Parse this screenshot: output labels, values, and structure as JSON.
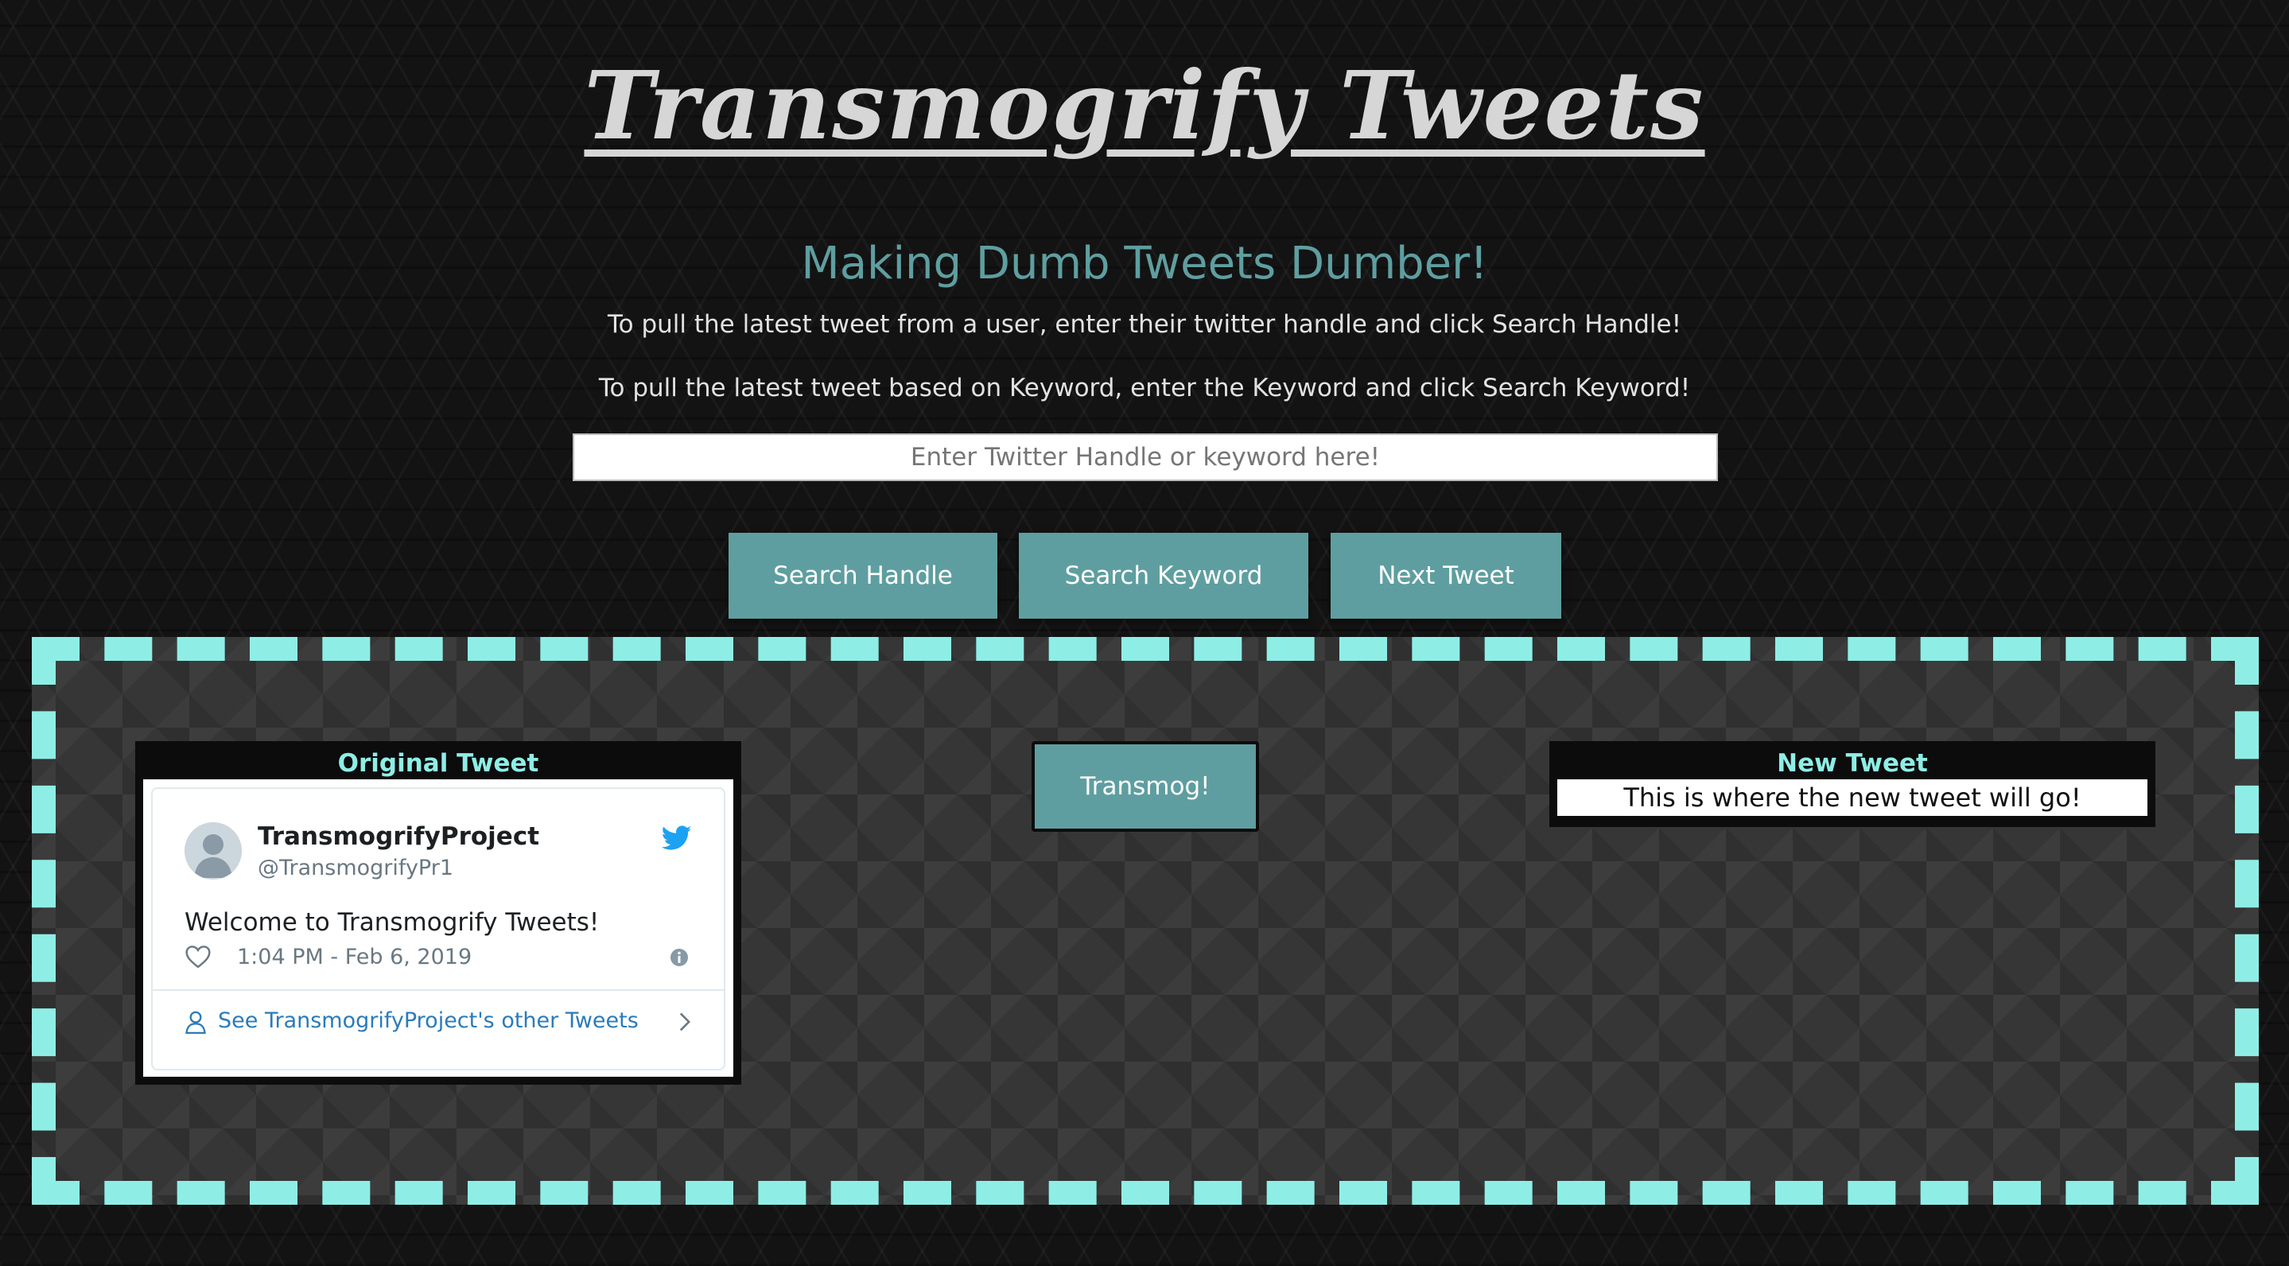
{
  "header": {
    "title": "Transmogrify Tweets",
    "subtitle": "Making Dumb Tweets Dumber!",
    "instruction_handle": "To pull the latest tweet from a user, enter their twitter handle and click Search Handle!",
    "instruction_keyword": "To pull the latest tweet based on Keyword, enter the Keyword and click Search Keyword!"
  },
  "search": {
    "placeholder": "Enter Twitter Handle or keyword here!",
    "value": ""
  },
  "buttons": {
    "search_handle": "Search Handle",
    "search_keyword": "Search Keyword",
    "next_tweet": "Next Tweet",
    "transmog": "Transmog!"
  },
  "original_tweet": {
    "title": "Original Tweet",
    "author_name": "TransmogrifyProject",
    "author_handle": "@TransmogrifyPr1",
    "text": "Welcome to Transmogrify Tweets!",
    "timestamp": "1:04 PM - Feb 6, 2019",
    "other_tweets_link": "See TransmogrifyProject's other Tweets"
  },
  "new_tweet": {
    "title": "New Tweet",
    "text": "This is where the new tweet will go!"
  },
  "icons": {
    "twitter": "twitter-bird-icon",
    "heart": "heart-icon",
    "info": "info-icon",
    "person": "person-icon",
    "chevron": "chevron-right-icon",
    "avatar": "default-avatar"
  },
  "colors": {
    "accent": "#5f9ea0",
    "dashed_border": "#8eeee6",
    "panel_title": "#8eeee6",
    "background": "#131313",
    "work_area": "#363636",
    "twitter_blue": "#1da1f2",
    "link_blue": "#2b7bb9"
  }
}
